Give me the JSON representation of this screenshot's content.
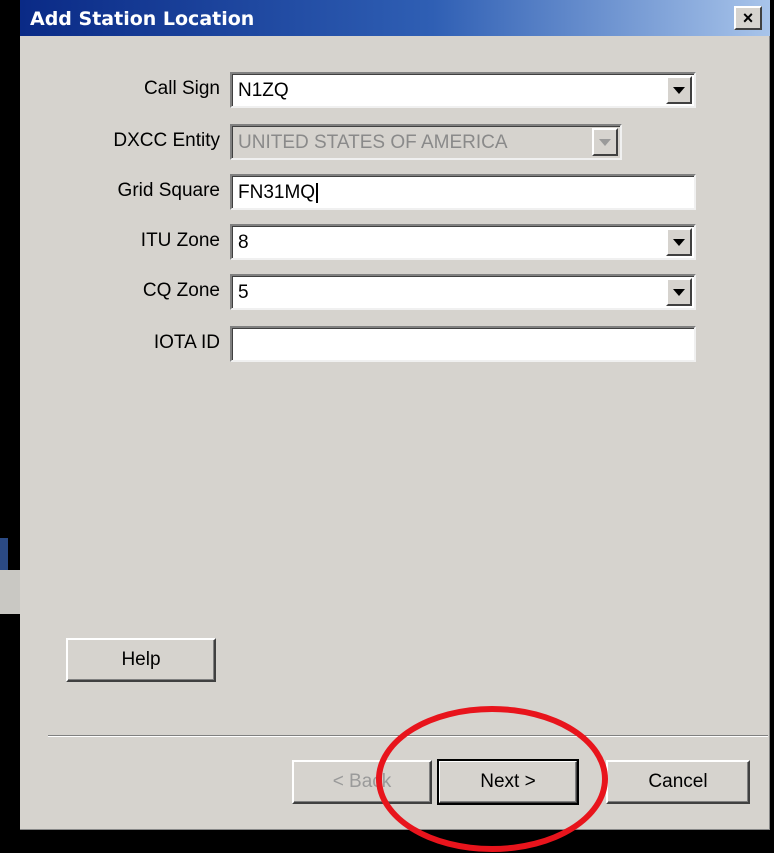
{
  "dialog": {
    "title": "Add Station Location",
    "close_label": "×"
  },
  "form": {
    "call_sign": {
      "label": "Call Sign",
      "value": "N1ZQ"
    },
    "dxcc_entity": {
      "label": "DXCC Entity",
      "value": "UNITED STATES OF AMERICA"
    },
    "grid_square": {
      "label": "Grid Square",
      "value": "FN31MQ"
    },
    "itu_zone": {
      "label": "ITU Zone",
      "value": "8"
    },
    "cq_zone": {
      "label": "CQ Zone",
      "value": "5"
    },
    "iota_id": {
      "label": "IOTA ID",
      "value": ""
    }
  },
  "buttons": {
    "help": "Help",
    "back": "< Back",
    "next": "Next >",
    "cancel": "Cancel"
  },
  "colors": {
    "annotation": "#e8141c",
    "titlebar_start": "#0a2a86",
    "dialog_bg": "#d6d3ce"
  },
  "icons": {
    "close": "close-icon",
    "dropdown": "chevron-down-icon"
  }
}
